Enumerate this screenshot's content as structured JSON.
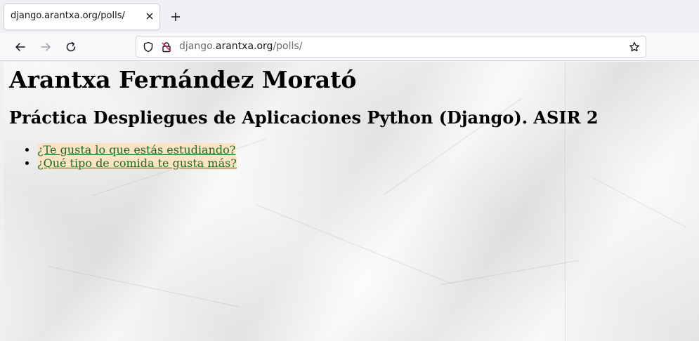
{
  "browser": {
    "tab": {
      "title": "django.arantxa.org/polls/",
      "close_icon": "close-icon"
    },
    "new_tab_icon": "plus-icon",
    "nav": {
      "back_icon": "arrow-left-icon",
      "forward_icon": "arrow-right-icon",
      "reload_icon": "reload-icon"
    },
    "urlbar": {
      "shield_icon": "shield-icon",
      "lock_icon": "insecure-lock-icon",
      "url_prefix": "django.",
      "url_domain": "arantxa.org",
      "url_path": "/polls/",
      "bookmark_icon": "star-icon"
    }
  },
  "page": {
    "title": "Arantxa Fernández Morató",
    "subtitle": "Práctica Despliegues de Aplicaciones Python (Django). ASIR 2",
    "polls": [
      {
        "question": "¿Te gusta lo que estás estudiando?"
      },
      {
        "question": "¿Qué tipo de comida te gusta más?"
      }
    ],
    "colors": {
      "link": "#1a6e1a",
      "link_highlight": "#fae3c6",
      "background": "#ececec"
    }
  }
}
